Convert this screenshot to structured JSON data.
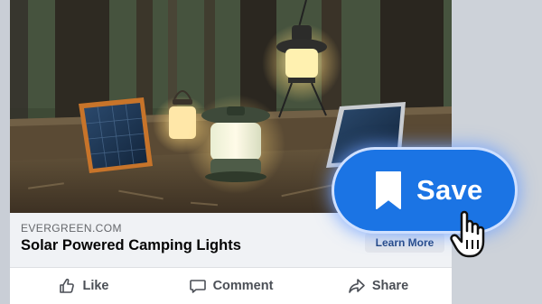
{
  "post": {
    "link": {
      "domain": "EVERGREEN.COM",
      "title": "Solar Powered Camping Lights",
      "cta_label": "Learn More"
    },
    "actions": [
      {
        "label": "Like",
        "icon": "thumbs-up-icon"
      },
      {
        "label": "Comment",
        "icon": "comment-bubble-icon"
      },
      {
        "label": "Share",
        "icon": "share-arrow-icon"
      }
    ]
  },
  "overlay": {
    "save_label": "Save",
    "save_icon": "bookmark-icon",
    "cursor_icon": "hand-pointer-icon"
  },
  "colors": {
    "accent": "#1b74e4",
    "card_bg": "#ffffff",
    "link_bg": "#f0f2f5",
    "page_bg": "#d9dde3"
  }
}
